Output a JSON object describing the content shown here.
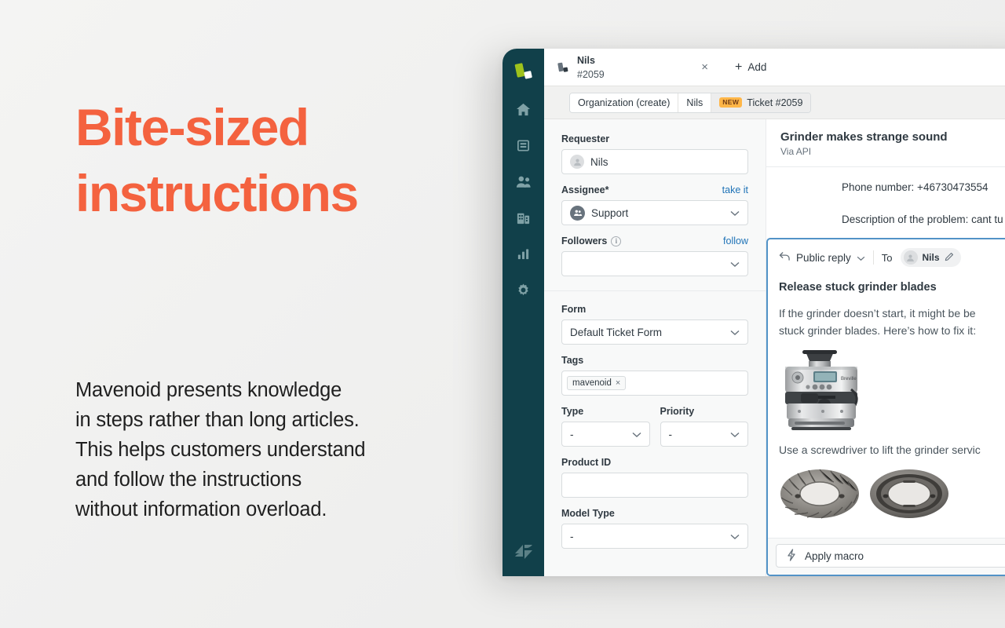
{
  "marketing": {
    "headline": "Bite-sized\ninstructions",
    "headline_color": "#f4623f",
    "body": "Mavenoid presents knowledge\nin steps rather than long articles.\nThis helps customers understand\nand follow the instructions\nwithout information overload."
  },
  "app": {
    "nav": {
      "logo_name": "zendesk-logo",
      "items": [
        {
          "icon": "home-icon",
          "label": "Home"
        },
        {
          "icon": "views-icon",
          "label": "Views"
        },
        {
          "icon": "customers-icon",
          "label": "Customers"
        },
        {
          "icon": "organizations-icon",
          "label": "Organizations"
        },
        {
          "icon": "reporting-icon",
          "label": "Reporting"
        },
        {
          "icon": "admin-gear-icon",
          "label": "Admin"
        }
      ],
      "bottom_logo_name": "zendesk-z-logo"
    },
    "tabs": {
      "open": {
        "icon": "ticket-icon",
        "title": "Nils",
        "subtitle": "#2059",
        "close_label": "×"
      },
      "add_label": "Add",
      "add_plus": "+"
    },
    "breadcrumbs": [
      {
        "label": "Organization (create)",
        "badge": "",
        "active": false
      },
      {
        "label": "Nils",
        "badge": "",
        "active": false
      },
      {
        "label": "Ticket #2059",
        "badge": "NEW",
        "active": true
      }
    ],
    "form": {
      "requester": {
        "label": "Requester",
        "value": "Nils"
      },
      "assignee": {
        "label": "Assignee*",
        "action": "take it",
        "value": "Support"
      },
      "followers": {
        "label": "Followers",
        "action": "follow",
        "value": ""
      },
      "form_field": {
        "label": "Form",
        "value": "Default Ticket Form"
      },
      "tags": {
        "label": "Tags",
        "chips": [
          {
            "text": "mavenoid",
            "remove": "×"
          }
        ]
      },
      "type": {
        "label": "Type",
        "value": "-"
      },
      "priority": {
        "label": "Priority",
        "value": "-"
      },
      "product_id": {
        "label": "Product ID",
        "value": ""
      },
      "model_type": {
        "label": "Model Type",
        "value": "-"
      }
    },
    "ticket": {
      "subject": "Grinder makes strange sound",
      "via": "Via API",
      "description_lines": [
        "Phone number: +46730473554",
        "Description of the problem: cant tu"
      ]
    },
    "composer": {
      "reply_type": "Public reply",
      "to_label": "To",
      "recipient": "Nils",
      "edit_icon": "pencil-icon",
      "reply_title": "Release stuck grinder blades",
      "paragraph_1": "If the grinder doesn’t start, it might be be\nstuck grinder blades. Here’s how to fix it:",
      "paragraph_2": "Use a screwdriver to lift the grinder servic",
      "image_1_name": "espresso-machine-photo",
      "image_2_name": "grinder-burr-photo-left",
      "image_3_name": "grinder-burr-photo-right"
    },
    "macro": {
      "icon": "lightning-bolt-icon",
      "label": "Apply macro"
    }
  },
  "colors": {
    "brand_coral": "#f4623f",
    "nav_dark": "#11404a",
    "link_blue": "#1f73b7",
    "badge_amber": "#ffb648",
    "composer_border": "#5293c7"
  }
}
